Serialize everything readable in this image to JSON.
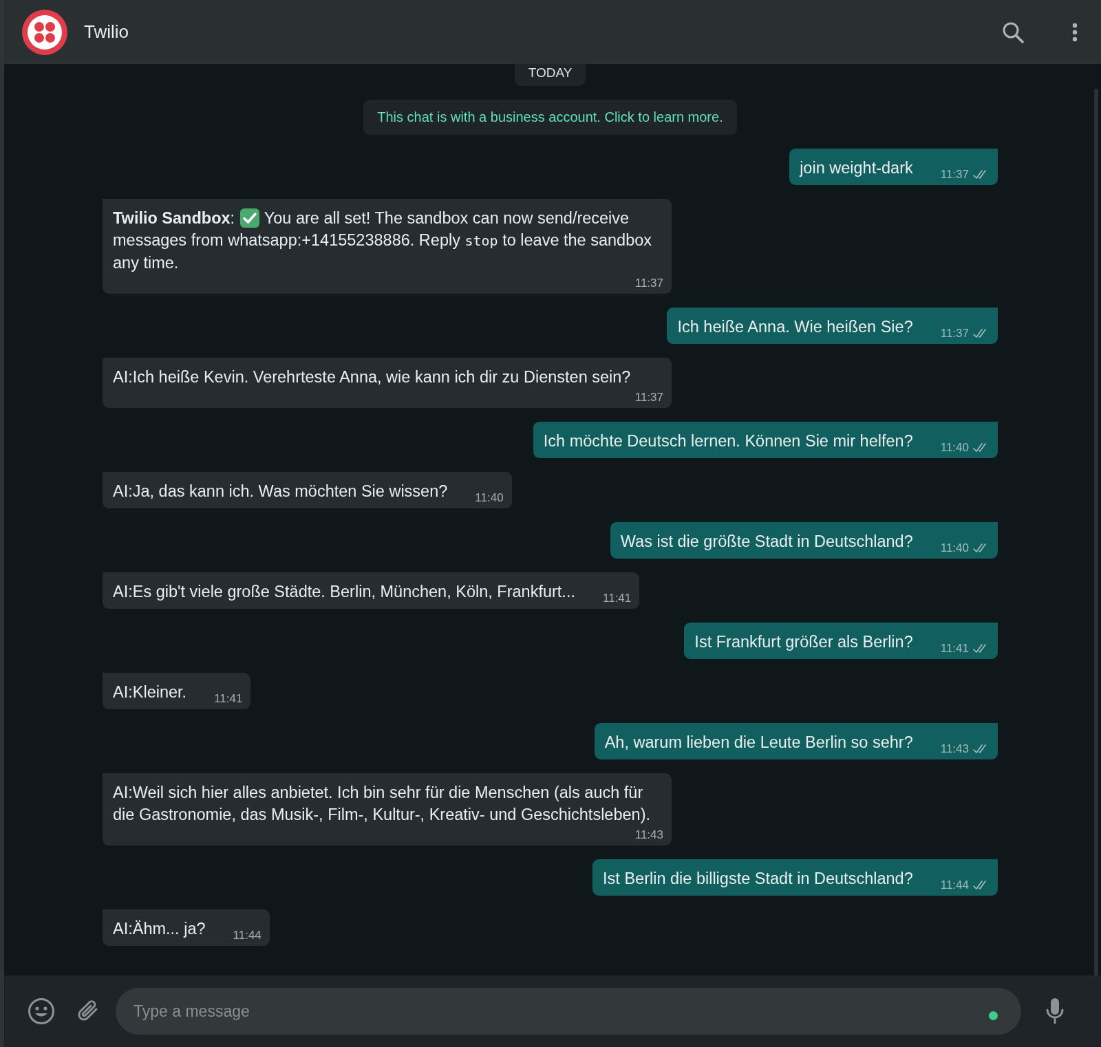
{
  "header": {
    "title": "Twilio"
  },
  "chat": {
    "date_chip": "TODAY",
    "notice": "This chat is with a business account. Click to learn more.",
    "messages": [
      {
        "kind": "out",
        "parts": [
          {
            "kind": "text",
            "text": "join weight-dark"
          }
        ],
        "time": "11:37"
      },
      {
        "kind": "in",
        "parts": [
          {
            "kind": "bold",
            "text": "Twilio Sandbox"
          },
          {
            "kind": "text",
            "text": ": "
          },
          {
            "kind": "check"
          },
          {
            "kind": "text",
            "text": " You are all set! The sandbox can now send/receive messages from whatsapp:+14155238886. Reply "
          },
          {
            "kind": "code",
            "text": "stop"
          },
          {
            "kind": "text",
            "text": " to leave the sandbox any time."
          }
        ],
        "time": "11:37"
      },
      {
        "kind": "out",
        "parts": [
          {
            "kind": "text",
            "text": "Ich heiße Anna. Wie heißen Sie?"
          }
        ],
        "time": "11:37"
      },
      {
        "kind": "in",
        "parts": [
          {
            "kind": "text",
            "text": "AI:Ich heiße Kevin. Verehrteste Anna, wie kann ich dir zu Diensten sein?"
          }
        ],
        "time": "11:37"
      },
      {
        "kind": "out",
        "parts": [
          {
            "kind": "text",
            "text": "Ich möchte Deutsch lernen. Können Sie mir helfen?"
          }
        ],
        "time": "11:40"
      },
      {
        "kind": "in",
        "parts": [
          {
            "kind": "text",
            "text": "AI:Ja, das kann ich. Was möchten Sie wissen?"
          }
        ],
        "time": "11:40"
      },
      {
        "kind": "out",
        "parts": [
          {
            "kind": "text",
            "text": "Was ist die größte Stadt in Deutschland?"
          }
        ],
        "time": "11:40"
      },
      {
        "kind": "in",
        "parts": [
          {
            "kind": "text",
            "text": "AI:Es gib't viele große Städte. Berlin, München, Köln, Frankfurt..."
          }
        ],
        "time": "11:41"
      },
      {
        "kind": "out",
        "parts": [
          {
            "kind": "text",
            "text": "Ist Frankfurt größer als Berlin?"
          }
        ],
        "time": "11:41"
      },
      {
        "kind": "in",
        "parts": [
          {
            "kind": "text",
            "text": "AI:Kleiner."
          }
        ],
        "time": "11:41"
      },
      {
        "kind": "out",
        "parts": [
          {
            "kind": "text",
            "text": "Ah, warum lieben die Leute Berlin so sehr?"
          }
        ],
        "time": "11:43"
      },
      {
        "kind": "in",
        "parts": [
          {
            "kind": "text",
            "text": "AI:Weil sich hier alles anbietet. Ich bin sehr für die Menschen (als auch für die Gastronomie, das Musik-, Film-, Kultur-, Kreativ- und Geschichtsleben)."
          }
        ],
        "time": "11:43"
      },
      {
        "kind": "out",
        "parts": [
          {
            "kind": "text",
            "text": "Ist Berlin die billigste Stadt in Deutschland?"
          }
        ],
        "time": "11:44"
      },
      {
        "kind": "in",
        "parts": [
          {
            "kind": "text",
            "text": "AI:Ähm... ja?"
          }
        ],
        "time": "11:44"
      }
    ]
  },
  "composer": {
    "placeholder": "Type a message"
  }
}
